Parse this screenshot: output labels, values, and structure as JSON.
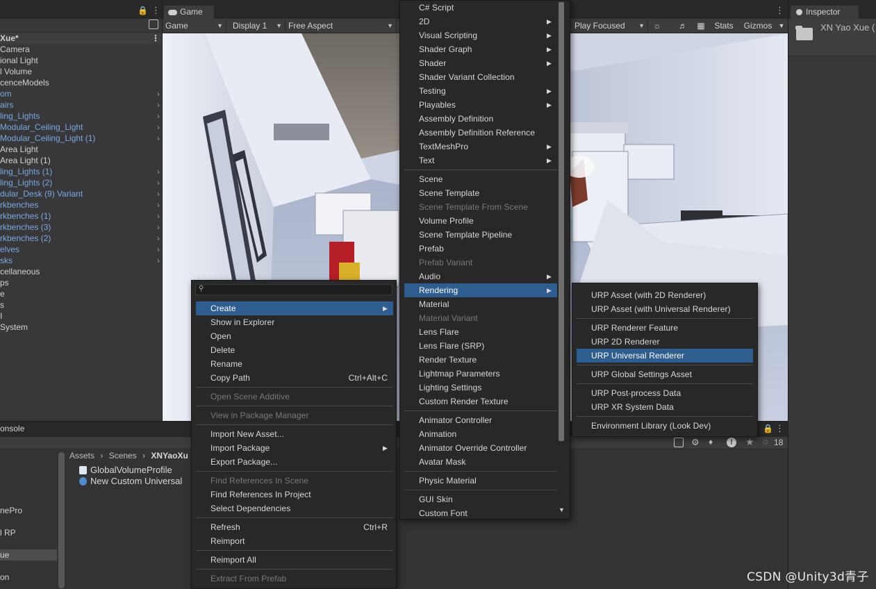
{
  "hierarchy": {
    "scene_name": "Xue*",
    "items": [
      {
        "label": "Camera",
        "prefab": false,
        "expandable": false
      },
      {
        "label": "ional Light",
        "prefab": false,
        "expandable": false
      },
      {
        "label": "l Volume",
        "prefab": false,
        "expandable": false
      },
      {
        "label": "cenceModels",
        "prefab": false,
        "expandable": false
      },
      {
        "label": "om",
        "prefab": true,
        "expandable": true
      },
      {
        "label": "airs",
        "prefab": true,
        "expandable": true
      },
      {
        "label": "ling_Lights",
        "prefab": true,
        "expandable": true
      },
      {
        "label": "Modular_Ceiling_Light",
        "prefab": true,
        "expandable": true
      },
      {
        "label": "Modular_Ceiling_Light (1)",
        "prefab": true,
        "expandable": true
      },
      {
        "label": "Area Light",
        "prefab": false,
        "expandable": false
      },
      {
        "label": "Area Light (1)",
        "prefab": false,
        "expandable": false
      },
      {
        "label": "ling_Lights (1)",
        "prefab": true,
        "expandable": true
      },
      {
        "label": "ling_Lights (2)",
        "prefab": true,
        "expandable": true
      },
      {
        "label": "dular_Desk (9) Variant",
        "prefab": true,
        "expandable": true
      },
      {
        "label": "rkbenches",
        "prefab": true,
        "expandable": true
      },
      {
        "label": "rkbenches (1)",
        "prefab": true,
        "expandable": true
      },
      {
        "label": "rkbenches (3)",
        "prefab": true,
        "expandable": true
      },
      {
        "label": "rkbenches (2)",
        "prefab": true,
        "expandable": true
      },
      {
        "label": "elves",
        "prefab": true,
        "expandable": true
      },
      {
        "label": "sks",
        "prefab": true,
        "expandable": true
      },
      {
        "label": "cellaneous",
        "prefab": false,
        "expandable": false
      },
      {
        "label": "ps",
        "prefab": false,
        "expandable": false
      },
      {
        "label": "e",
        "prefab": false,
        "expandable": false
      },
      {
        "label": "s",
        "prefab": false,
        "expandable": false
      },
      {
        "label": "I",
        "prefab": false,
        "expandable": false
      },
      {
        "label": "System",
        "prefab": false,
        "expandable": false
      }
    ]
  },
  "game": {
    "tab_label": "Game",
    "toolbar": {
      "mode": "Game",
      "display": "Display 1",
      "aspect": "Free Aspect",
      "play_focused": "Play Focused",
      "stats": "Stats",
      "gizmos": "Gizmos"
    }
  },
  "inspector": {
    "tab_label": "Inspector",
    "object_name": "XN Yao Xue (",
    "hidden_count": "18"
  },
  "console": {
    "tab_label": "onsole"
  },
  "project": {
    "breadcrumb": [
      "Assets",
      "Scenes",
      "XNYaoXu"
    ],
    "files": [
      "GlobalVolumeProfile",
      "New Custom Universal"
    ],
    "left_items": [
      {
        "label": "nePro",
        "selected": false
      },
      {
        "label": "l RP",
        "selected": false
      },
      {
        "label": "ue",
        "selected": true
      },
      {
        "label": "on",
        "selected": false
      }
    ]
  },
  "context_menu": {
    "search_placeholder": "",
    "items": [
      {
        "label": "Create",
        "submenu": true,
        "highlighted": true
      },
      {
        "label": "Show in Explorer"
      },
      {
        "label": "Open"
      },
      {
        "label": "Delete"
      },
      {
        "label": "Rename"
      },
      {
        "label": "Copy Path",
        "shortcut": "Ctrl+Alt+C"
      },
      {
        "sep": true
      },
      {
        "label": "Open Scene Additive",
        "disabled": true
      },
      {
        "sep": true
      },
      {
        "label": "View in Package Manager",
        "disabled": true
      },
      {
        "sep": true
      },
      {
        "label": "Import New Asset..."
      },
      {
        "label": "Import Package",
        "submenu": true
      },
      {
        "label": "Export Package..."
      },
      {
        "sep": true
      },
      {
        "label": "Find References In Scene",
        "disabled": true
      },
      {
        "label": "Find References In Project"
      },
      {
        "label": "Select Dependencies"
      },
      {
        "sep": true
      },
      {
        "label": "Refresh",
        "shortcut": "Ctrl+R"
      },
      {
        "label": "Reimport"
      },
      {
        "sep": true
      },
      {
        "label": "Reimport All"
      },
      {
        "sep": true
      },
      {
        "label": "Extract From Prefab",
        "disabled": true
      }
    ]
  },
  "create_menu": {
    "items": [
      {
        "label": "C# Script"
      },
      {
        "label": "2D",
        "submenu": true
      },
      {
        "label": "Visual Scripting",
        "submenu": true
      },
      {
        "label": "Shader Graph",
        "submenu": true
      },
      {
        "label": "Shader",
        "submenu": true
      },
      {
        "label": "Shader Variant Collection"
      },
      {
        "label": "Testing",
        "submenu": true
      },
      {
        "label": "Playables",
        "submenu": true
      },
      {
        "label": "Assembly Definition"
      },
      {
        "label": "Assembly Definition Reference"
      },
      {
        "label": "TextMeshPro",
        "submenu": true
      },
      {
        "label": "Text",
        "submenu": true
      },
      {
        "sep": true
      },
      {
        "label": "Scene"
      },
      {
        "label": "Scene Template"
      },
      {
        "label": "Scene Template From Scene",
        "disabled": true
      },
      {
        "label": "Volume Profile"
      },
      {
        "label": "Scene Template Pipeline"
      },
      {
        "label": "Prefab"
      },
      {
        "label": "Prefab Variant",
        "disabled": true
      },
      {
        "label": "Audio",
        "submenu": true
      },
      {
        "label": "Rendering",
        "submenu": true,
        "highlighted": true
      },
      {
        "label": "Material"
      },
      {
        "label": "Material Variant",
        "disabled": true
      },
      {
        "label": "Lens Flare"
      },
      {
        "label": "Lens Flare (SRP)"
      },
      {
        "label": "Render Texture"
      },
      {
        "label": "Lightmap Parameters"
      },
      {
        "label": "Lighting Settings"
      },
      {
        "label": "Custom Render Texture"
      },
      {
        "sep": true
      },
      {
        "label": "Animator Controller"
      },
      {
        "label": "Animation"
      },
      {
        "label": "Animator Override Controller"
      },
      {
        "label": "Avatar Mask"
      },
      {
        "sep": true
      },
      {
        "label": "Physic Material"
      },
      {
        "sep": true
      },
      {
        "label": "GUI Skin"
      },
      {
        "label": "Custom Font"
      }
    ]
  },
  "rendering_menu": {
    "items": [
      {
        "label": "URP Asset (with 2D Renderer)"
      },
      {
        "label": "URP Asset (with Universal Renderer)"
      },
      {
        "sep": true
      },
      {
        "label": "URP Renderer Feature"
      },
      {
        "label": "URP 2D Renderer"
      },
      {
        "label": "URP Universal Renderer",
        "highlighted": true
      },
      {
        "sep": true
      },
      {
        "label": "URP Global Settings Asset"
      },
      {
        "sep": true
      },
      {
        "label": "URP Post-process Data"
      },
      {
        "label": "URP XR System Data"
      },
      {
        "sep": true
      },
      {
        "label": "Environment Library (Look Dev)"
      }
    ]
  },
  "watermark": "CSDN @Unity3d青子",
  "colors": {
    "highlight": "#2e5d8f",
    "prefab_text": "#7ba7e6",
    "menu_bg": "#282828",
    "panel_bg": "#383838"
  }
}
